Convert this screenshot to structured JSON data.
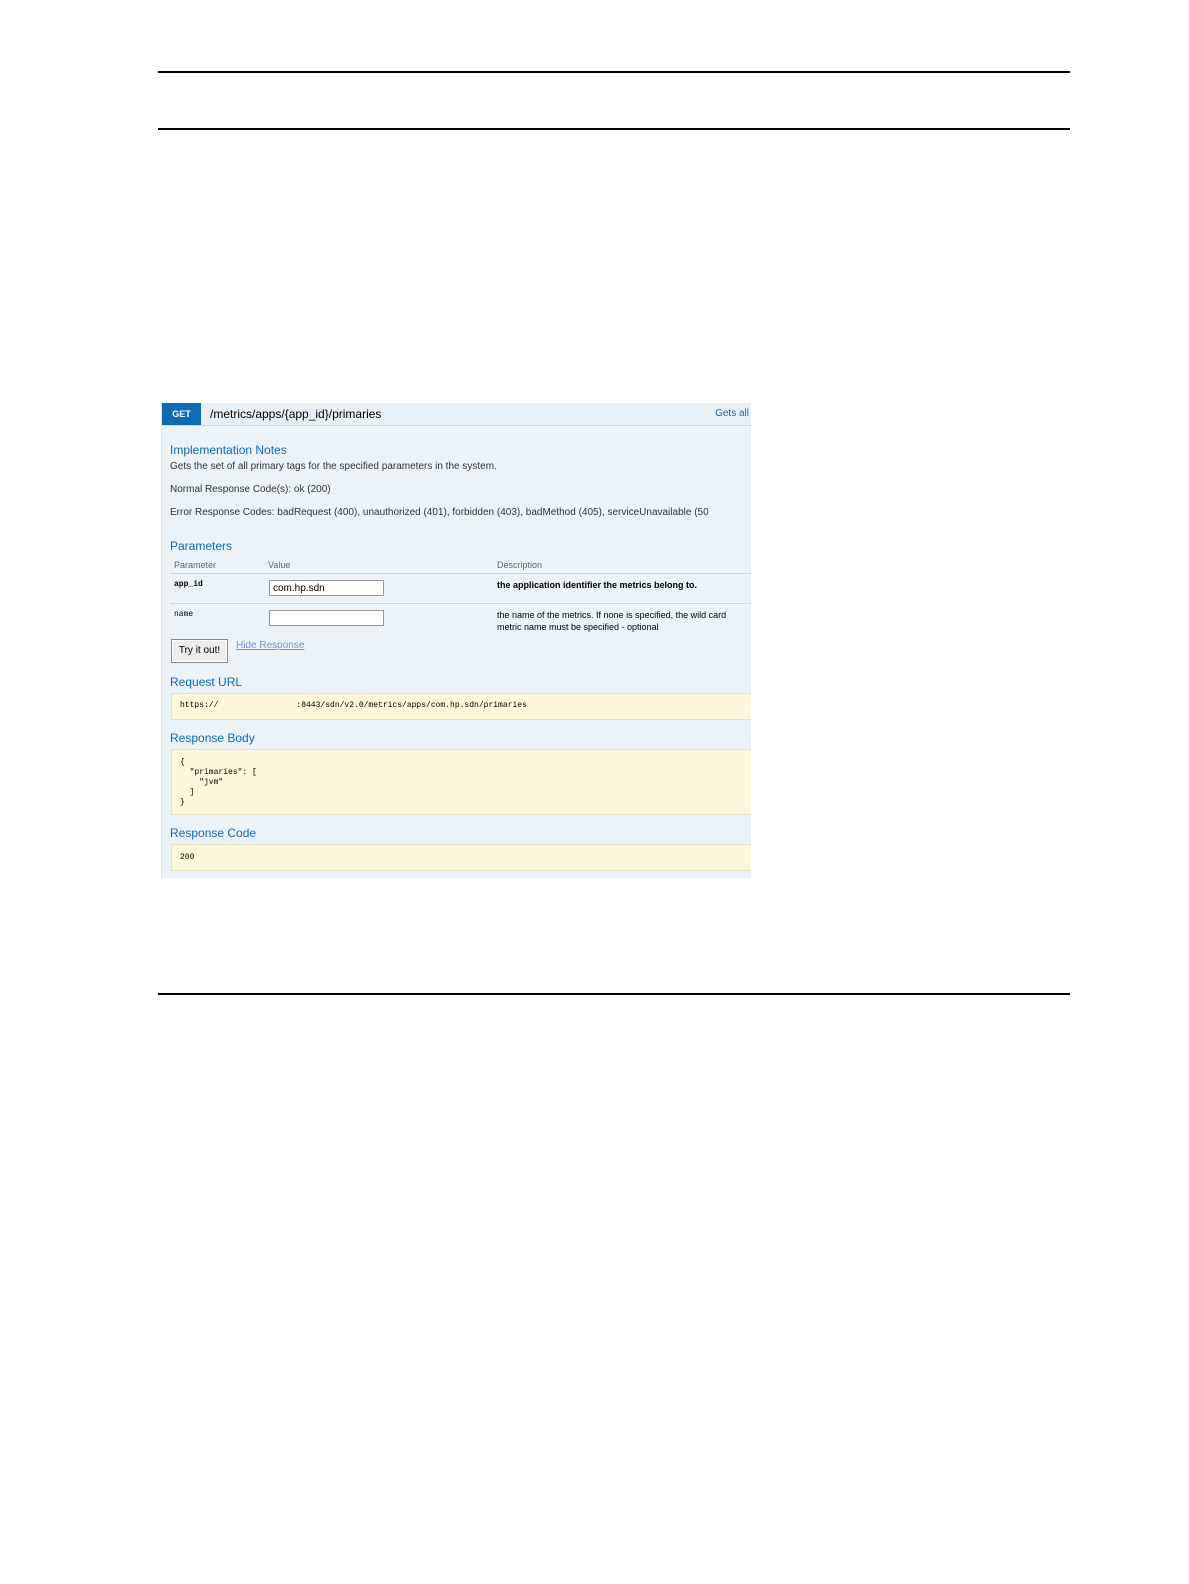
{
  "operation": {
    "method": "GET",
    "path": "/metrics/apps/{app_id}/primaries",
    "summary": "Gets all"
  },
  "implementation_notes": {
    "heading": "Implementation Notes",
    "description": "Gets the set of all primary tags for the specified parameters in the system.",
    "normal_codes": "Normal Response Code(s): ok (200)",
    "error_codes": "Error Response Codes: badRequest (400), unauthorized (401), forbidden (403), badMethod (405), serviceUnavailable (50"
  },
  "parameters": {
    "heading": "Parameters",
    "columns": [
      "Parameter",
      "Value",
      "Description"
    ],
    "rows": [
      {
        "name": "app_id",
        "value": "com.hp.sdn",
        "description": "the application identifier the metrics belong to.",
        "description2": ""
      },
      {
        "name": "name",
        "value": "",
        "description": "the name of the metrics. If none is specified, the wild card",
        "description2": "metric name must be specified  - optional"
      }
    ]
  },
  "actions": {
    "try_label": "Try it out!",
    "hide_label": "Hide Response"
  },
  "request_url": {
    "heading": "Request URL",
    "prefix": "https://",
    "suffix": ":8443/sdn/v2.0/metrics/apps/com.hp.sdn/primaries"
  },
  "response_body": {
    "heading": "Response Body",
    "content": "{\n  \"primaries\": [\n    \"jvm\"\n  ]\n}"
  },
  "response_code": {
    "heading": "Response Code",
    "value": "200"
  },
  "colors": {
    "method_bg": "#0f6ab4",
    "panel_bg": "#ebf3f9",
    "result_box_bg": "#fcf6db"
  }
}
